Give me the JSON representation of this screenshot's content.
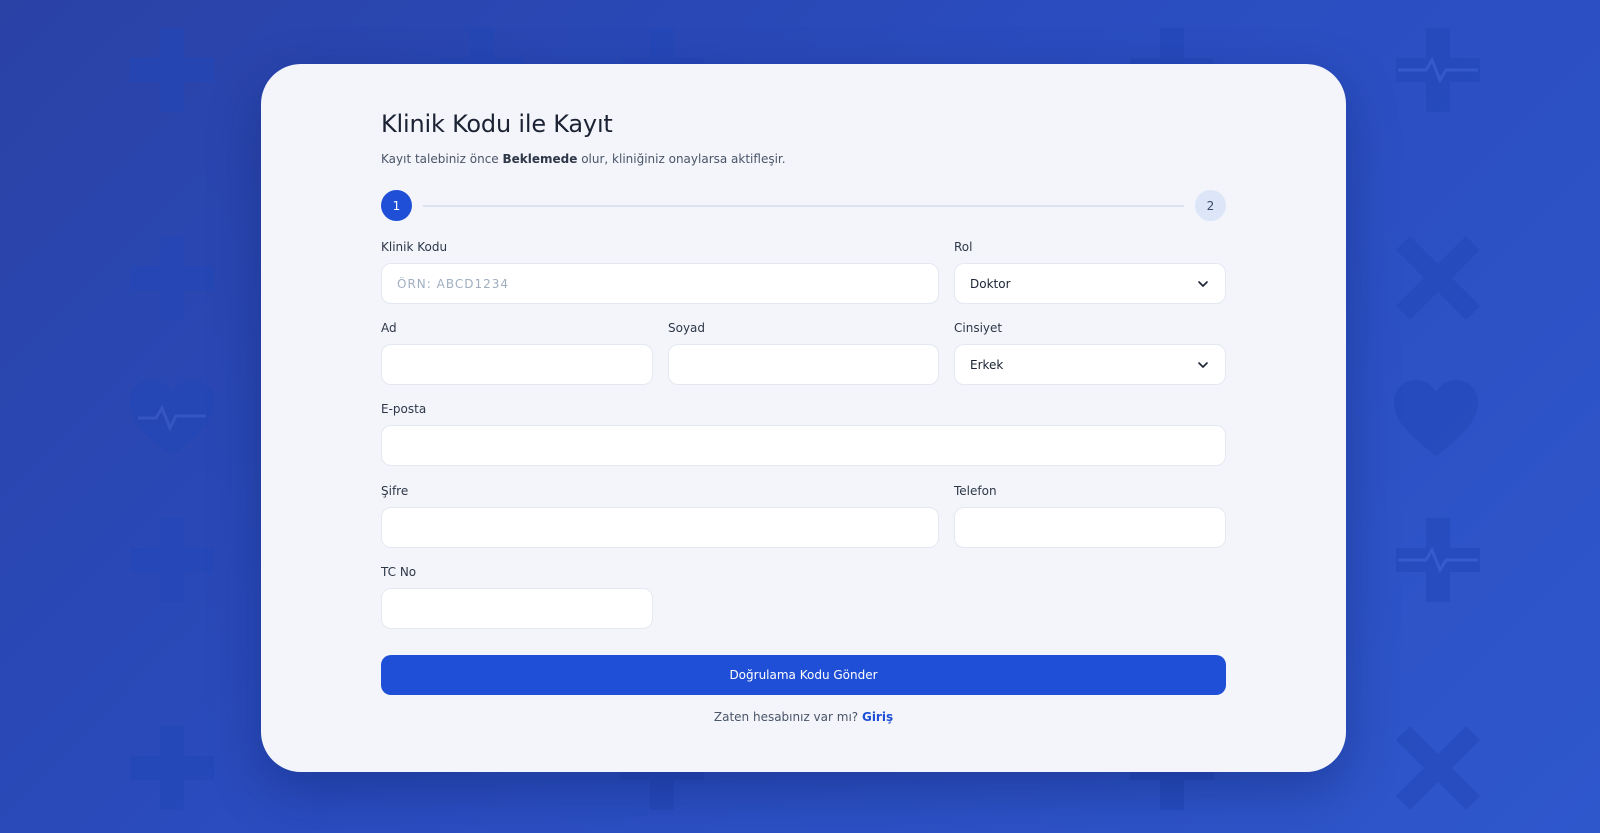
{
  "form": {
    "title": "Klinik Kodu ile Kayıt",
    "subtitle_before": "Kayıt talebiniz önce ",
    "subtitle_bold": "Beklemede",
    "subtitle_after": " olur, kliniğiniz onaylarsa aktifleşir.",
    "steps": [
      "1",
      "2"
    ],
    "active_step": 1,
    "fields": {
      "clinic_code": {
        "label": "Klinik Kodu",
        "placeholder": "ÖRN: ABCD1234",
        "value": ""
      },
      "role": {
        "label": "Rol",
        "value": "Doktor"
      },
      "first_name": {
        "label": "Ad",
        "value": ""
      },
      "last_name": {
        "label": "Soyad",
        "value": ""
      },
      "gender": {
        "label": "Cinsiyet",
        "value": "Erkek"
      },
      "email": {
        "label": "E-posta",
        "value": ""
      },
      "password": {
        "label": "Şifre",
        "value": ""
      },
      "phone": {
        "label": "Telefon",
        "value": ""
      },
      "tc_no": {
        "label": "TC No",
        "value": ""
      }
    },
    "submit_label": "Doğrulama Kodu Gönder",
    "footer_text": "Zaten hesabınız var mı? ",
    "footer_link": "Giriş"
  },
  "colors": {
    "primary": "#1e4fd6",
    "background": "#2a48b8",
    "card": "#f3f5fa"
  },
  "icons": [
    "medical-cross-icon",
    "heart-pulse-icon",
    "caduceus-icon",
    "chevron-down-icon"
  ]
}
